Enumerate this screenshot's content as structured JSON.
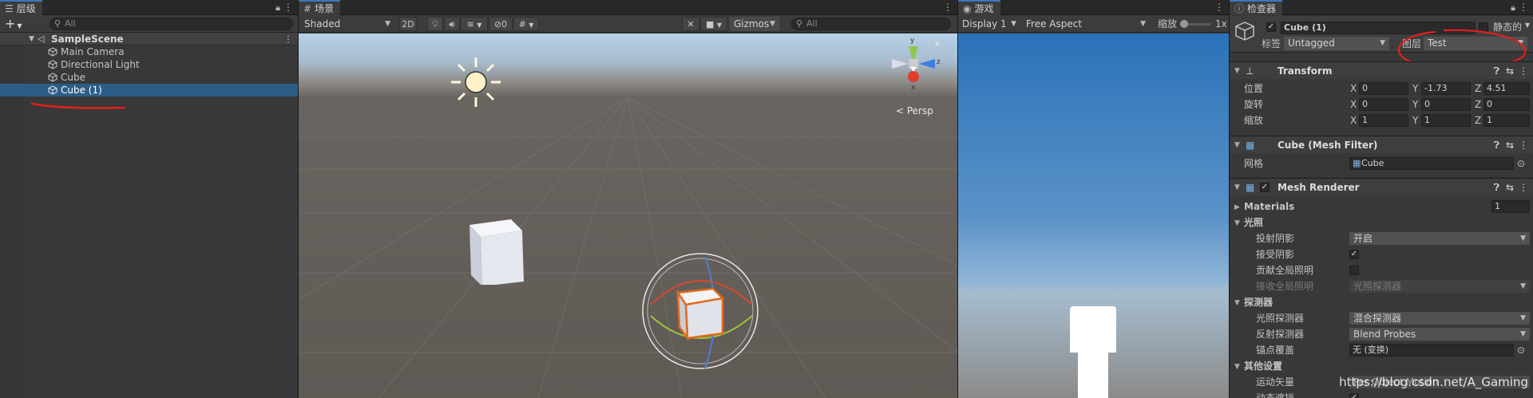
{
  "hierarchy": {
    "tab": "层级",
    "add_label": "+",
    "search_placeholder": "All",
    "scene_name": "SampleScene",
    "items": [
      {
        "label": "Main Camera"
      },
      {
        "label": "Directional Light"
      },
      {
        "label": "Cube"
      },
      {
        "label": "Cube (1)"
      }
    ]
  },
  "scene": {
    "tab": "场景",
    "shading": "Shaded",
    "mode_2d": "2D",
    "hidden_count": "0",
    "gizmos": "Gizmos",
    "search_placeholder": "All",
    "persp_label": "< Persp",
    "axis_y": "y",
    "axis_z": "z",
    "axis_x": "x"
  },
  "game": {
    "tab": "游戏",
    "display": "Display 1",
    "aspect": "Free Aspect",
    "scale_label": "缩放",
    "scale_value": "1x"
  },
  "inspector": {
    "tab": "检查器",
    "object_name": "Cube (1)",
    "static_label": "静态的",
    "tag_label": "标签",
    "tag_value": "Untagged",
    "layer_label": "图层",
    "layer_value": "Test",
    "transform": {
      "title": "Transform",
      "position_label": "位置",
      "rotation_label": "旋转",
      "scale_label": "缩放",
      "position": {
        "x": "0",
        "y": "-1.73",
        "z": "4.51"
      },
      "rotation": {
        "x": "0",
        "y": "0",
        "z": "0"
      },
      "scale": {
        "x": "1",
        "y": "1",
        "z": "1"
      }
    },
    "mesh_filter": {
      "title": "Cube (Mesh Filter)",
      "mesh_label": "网格",
      "mesh_value": "Cube"
    },
    "mesh_renderer": {
      "title": "Mesh Renderer",
      "materials_label": "Materials",
      "materials_count": "1",
      "lighting_label": "光照",
      "cast_shadows_label": "投射阴影",
      "cast_shadows_value": "开启",
      "receive_shadows_label": "接受阴影",
      "contribute_gi_label": "贡献全局照明",
      "receive_gi_label": "接收全局照明",
      "receive_gi_value": "光照探测器",
      "probes_label": "探测器",
      "light_probes_label": "光照探测器",
      "light_probes_value": "混合探测器",
      "reflection_probes_label": "反射探测器",
      "reflection_probes_value": "Blend Probes",
      "anchor_override_label": "锚点覆盖",
      "anchor_override_value": "无 (变换)",
      "other_label": "其他设置",
      "motion_vectors_label": "运动矢量",
      "motion_vectors_value": "Per Object Motion",
      "dynamic_occlusion_label": "动态遮挡"
    }
  },
  "watermark": "https://blog.csdn.net/A_Gaming",
  "colors": {
    "selection": "#2c5d87",
    "annotation": "#e0201c",
    "tab_accent": "#3a79bb"
  }
}
